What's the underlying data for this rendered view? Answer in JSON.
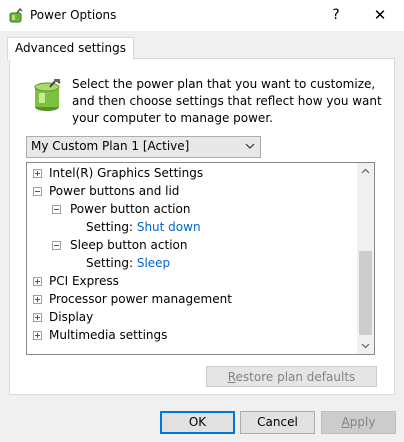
{
  "window": {
    "title": "Power Options",
    "help_glyph": "?",
    "close_glyph": "✕"
  },
  "tab": {
    "label": "Advanced settings"
  },
  "description": "Select the power plan that you want to customize, and then choose settings that reflect how you want your computer to manage power.",
  "plan_select": {
    "value": "My Custom Plan 1 [Active]"
  },
  "tree": {
    "items": [
      {
        "label": "Intel(R) Graphics Settings",
        "expanded": false
      },
      {
        "label": "Power buttons and lid",
        "expanded": true
      },
      {
        "label": "Power button action",
        "expanded": true
      },
      {
        "setting_label": "Setting:",
        "setting_value": "Shut down"
      },
      {
        "label": "Sleep button action",
        "expanded": true
      },
      {
        "setting_label": "Setting:",
        "setting_value": "Sleep"
      },
      {
        "label": "PCI Express",
        "expanded": false
      },
      {
        "label": "Processor power management",
        "expanded": false
      },
      {
        "label": "Display",
        "expanded": false
      },
      {
        "label": "Multimedia settings",
        "expanded": false
      }
    ]
  },
  "buttons": {
    "restore_first": "R",
    "restore_rest": "estore plan defaults",
    "ok": "OK",
    "cancel": "Cancel",
    "apply_first": "A",
    "apply_rest": "pply"
  },
  "colors": {
    "link": "#0066cc",
    "disabled_text": "#838383",
    "focus_border": "#0078d7"
  }
}
